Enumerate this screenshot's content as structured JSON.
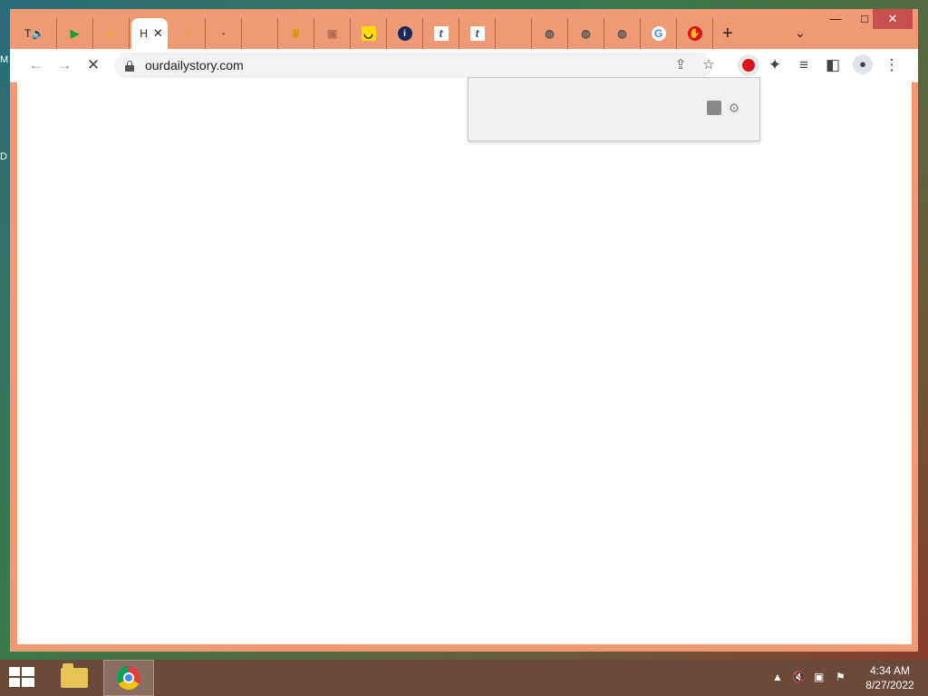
{
  "desktop": {
    "left_labels": [
      "M",
      "D"
    ]
  },
  "tabs": [
    {
      "title": "T",
      "icon": "speaker-icon"
    },
    {
      "title": "",
      "icon": "green-play-icon"
    },
    {
      "title": "",
      "icon": "yellow-cursor-icon"
    },
    {
      "title": "H",
      "icon": "",
      "active": true
    },
    {
      "title": "",
      "icon": "yellow-face-icon"
    },
    {
      "title": "",
      "icon": "dot-icon"
    },
    {
      "title": "",
      "icon": "blank-icon"
    },
    {
      "title": "",
      "icon": "crown-icon"
    },
    {
      "title": "",
      "icon": "box-icon"
    },
    {
      "title": "",
      "icon": "smile-icon"
    },
    {
      "title": "",
      "icon": "blue-drop-icon"
    },
    {
      "title": "",
      "icon": "t-icon"
    },
    {
      "title": "",
      "icon": "t-icon"
    },
    {
      "title": "",
      "icon": "blank-icon"
    },
    {
      "title": "",
      "icon": "globe-icon"
    },
    {
      "title": "",
      "icon": "globe-icon"
    },
    {
      "title": "",
      "icon": "globe-icon"
    },
    {
      "title": "",
      "icon": "google-icon"
    },
    {
      "title": "",
      "icon": "red-shield-icon"
    }
  ],
  "toolbar": {
    "url": "ourdailystory.com",
    "new_tab_label": "+",
    "tab_search_label": "⌄"
  },
  "taskbar": {
    "time": "4:34 AM",
    "date": "8/27/2022"
  },
  "colors": {
    "frame": "#ef9a75",
    "accent_red": "#c84f4f",
    "taskbar": "#6b4a3a"
  }
}
